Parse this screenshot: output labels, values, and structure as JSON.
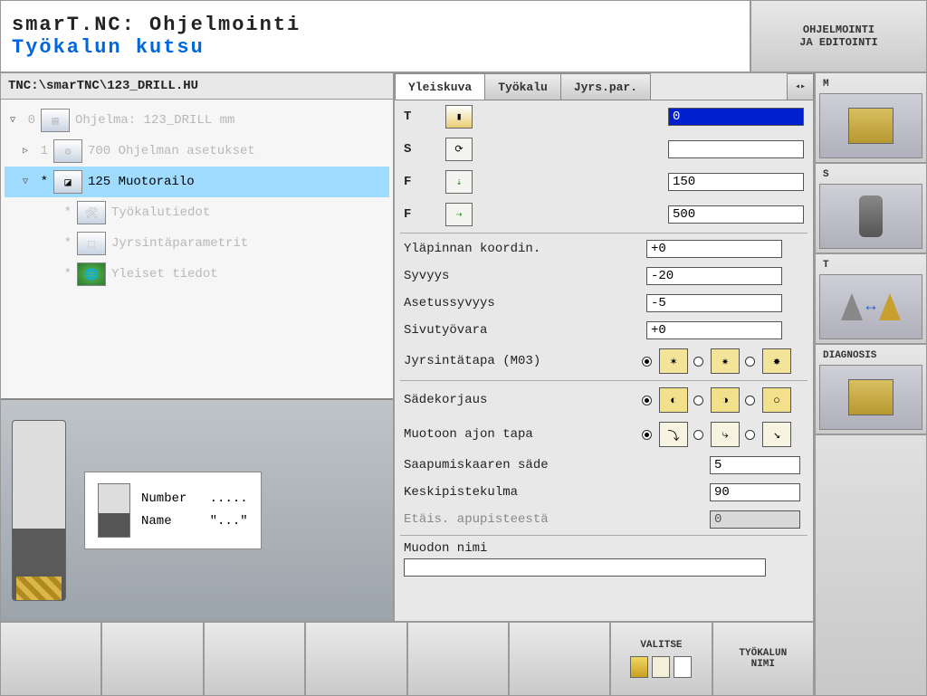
{
  "header": {
    "title1": "smarT.NC: Ohjelmointi",
    "title2": "Työkalun kutsu",
    "corner_line1": "OHJELMOINTI",
    "corner_line2": "JA EDITOINTI"
  },
  "path": "TNC:\\smarTNC\\123_DRILL.HU",
  "tree": {
    "items": [
      {
        "tri": "▽",
        "num": "0",
        "label": "Ohjelma: 123_DRILL mm"
      },
      {
        "tri": "▷",
        "num": "1",
        "label": "700 Ohjelman asetukset"
      },
      {
        "tri": "▽",
        "num": "*",
        "label": "125 Muotorailo",
        "selected": true
      },
      {
        "tri": "",
        "num": "*",
        "label": "Työkalutiedot"
      },
      {
        "tri": "",
        "num": "*",
        "label": "Jyrsintäparametrit"
      },
      {
        "tri": "",
        "num": "*",
        "label": "Yleiset tiedot"
      }
    ]
  },
  "preview": {
    "number_label": "Number",
    "number_value": ".....",
    "name_label": "Name",
    "name_value": "\"...\""
  },
  "tabs": [
    "Yleiskuva",
    "Työkalu",
    "Jyrs.par."
  ],
  "form": {
    "T": {
      "label": "T",
      "value": "0"
    },
    "S": {
      "label": "S",
      "value": ""
    },
    "F1": {
      "label": "F",
      "value": "150"
    },
    "F2": {
      "label": "F",
      "value": "500"
    },
    "top_coord": {
      "label": "Yläpinnan koordin.",
      "value": "+0"
    },
    "depth": {
      "label": "Syvyys",
      "value": "-20"
    },
    "plunge": {
      "label": "Asetussyvyys",
      "value": "-5"
    },
    "side_allow": {
      "label": "Sivutyövara",
      "value": "+0"
    },
    "milling_mode": {
      "label": "Jyrsintätapa (M03)"
    },
    "radius_comp": {
      "label": "Sädekorjaus"
    },
    "approach": {
      "label": "Muotoon ajon tapa"
    },
    "arc_radius": {
      "label": "Saapumiskaaren säde",
      "value": "5"
    },
    "center_angle": {
      "label": "Keskipistekulma",
      "value": "90"
    },
    "aux_dist": {
      "label": "Etäis. apupisteestä",
      "value": "0"
    },
    "shape_name": {
      "label": "Muodon nimi",
      "value": ""
    }
  },
  "right_buttons": [
    {
      "label": "M"
    },
    {
      "label": "S"
    },
    {
      "label": "T"
    },
    {
      "label": "DIAGNOSIS"
    }
  ],
  "softkeys": {
    "valitse": "VALITSE",
    "tool_name_1": "TYÖKALUN",
    "tool_name_2": "NIMI"
  }
}
